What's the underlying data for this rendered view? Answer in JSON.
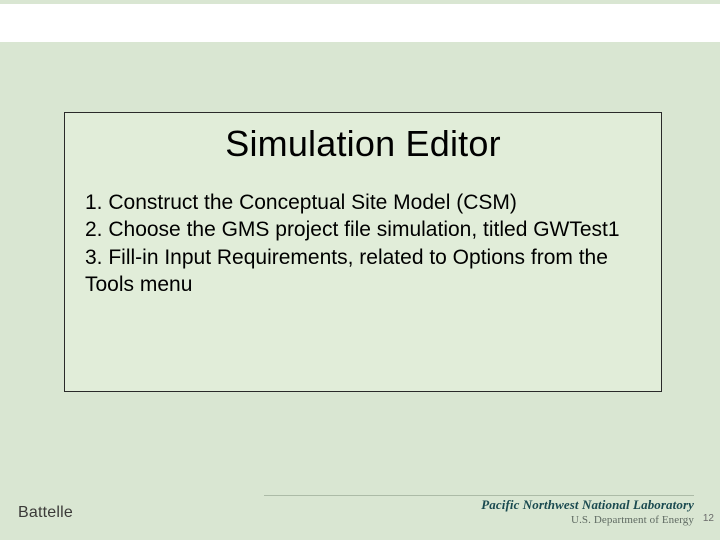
{
  "slide": {
    "title": "Simulation Editor",
    "body": "1. Construct the Conceptual Site Model (CSM)\n2. Choose the GMS project file simulation, titled GWTest1\n3. Fill-in Input Requirements, related to Options from the Tools menu"
  },
  "footer": {
    "left": "Battelle",
    "right_line1": "Pacific Northwest National Laboratory",
    "right_line2": "U.S. Department of Energy"
  },
  "page_number": "12"
}
